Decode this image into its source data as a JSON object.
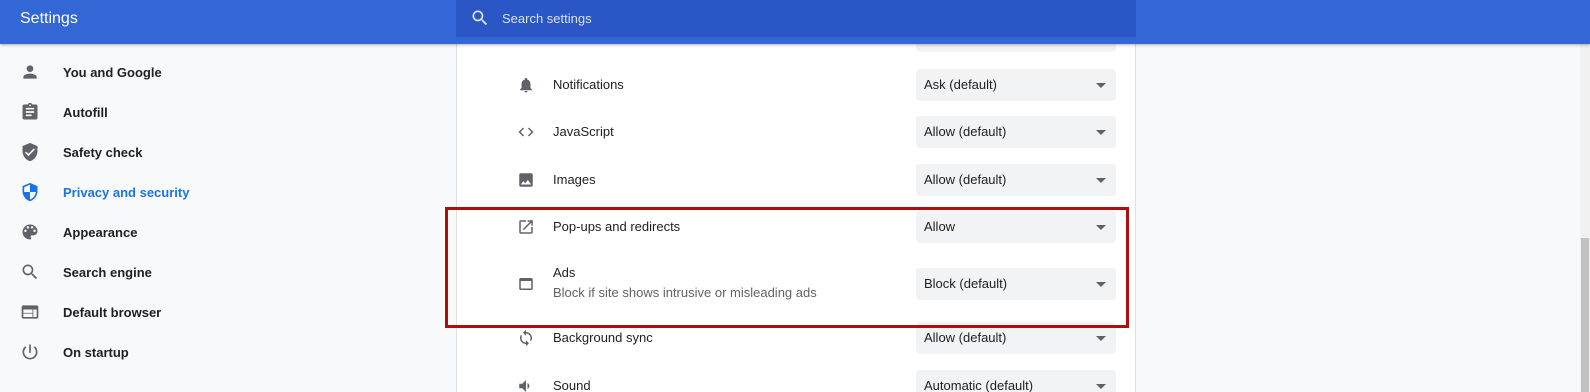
{
  "header": {
    "title": "Settings"
  },
  "search": {
    "placeholder": "Search settings",
    "icon": "search-icon"
  },
  "sidebar": {
    "items": [
      {
        "label": "You and Google",
        "icon": "person-icon",
        "active": false
      },
      {
        "label": "Autofill",
        "icon": "clipboard-icon",
        "active": false
      },
      {
        "label": "Safety check",
        "icon": "shield-check-icon",
        "active": false
      },
      {
        "label": "Privacy and security",
        "icon": "shield-icon",
        "active": true
      },
      {
        "label": "Appearance",
        "icon": "palette-icon",
        "active": false
      },
      {
        "label": "Search engine",
        "icon": "search-icon",
        "active": false
      },
      {
        "label": "Default browser",
        "icon": "browser-icon",
        "active": false
      },
      {
        "label": "On startup",
        "icon": "power-icon",
        "active": false
      }
    ]
  },
  "content": {
    "rows": [
      {
        "label": "Notifications",
        "value": "Ask (default)",
        "icon": "bell-icon"
      },
      {
        "label": "JavaScript",
        "value": "Allow (default)",
        "icon": "code-icon"
      },
      {
        "label": "Images",
        "value": "Allow (default)",
        "icon": "image-icon"
      },
      {
        "label": "Pop-ups and redirects",
        "value": "Allow",
        "icon": "open-in-new-icon"
      },
      {
        "label": "Ads",
        "sublabel": "Block if site shows intrusive or misleading ads",
        "value": "Block (default)",
        "icon": "window-icon"
      },
      {
        "label": "Background sync",
        "value": "Allow (default)",
        "icon": "sync-icon"
      },
      {
        "label": "Sound",
        "value": "Automatic (default)",
        "icon": "volume-icon"
      }
    ]
  },
  "colors": {
    "accent": "#3367d6",
    "active": "#1a73e8",
    "highlight": "#b00d0d"
  }
}
